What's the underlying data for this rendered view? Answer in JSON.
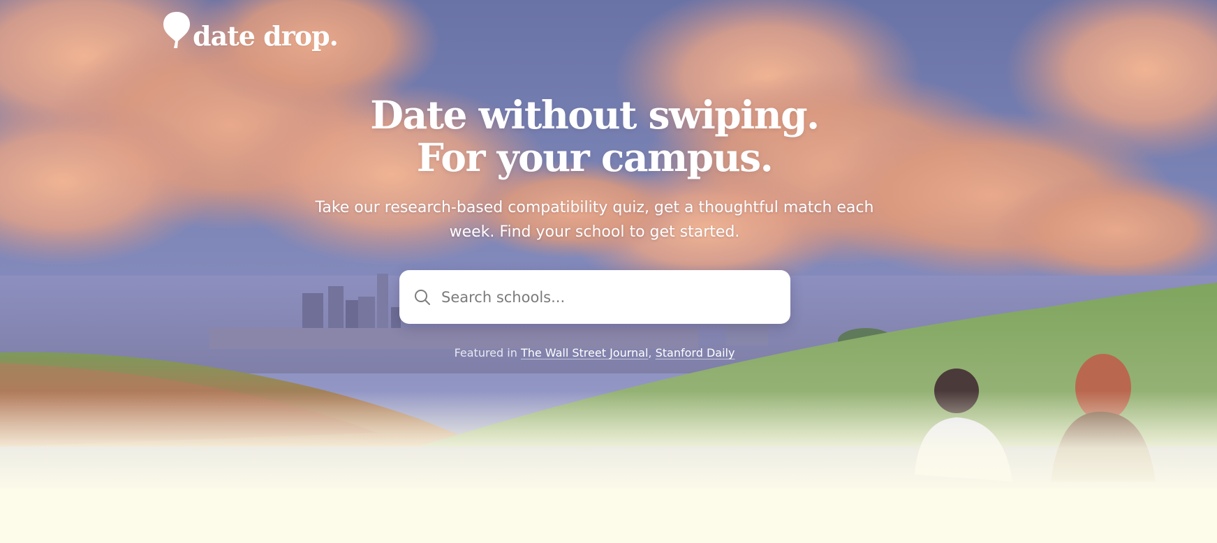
{
  "brand": {
    "name": "date drop.",
    "logo_icon": "balloon-pin-icon"
  },
  "hero": {
    "headline_line1": "Date without swiping.",
    "headline_line2": "For your campus.",
    "subheadline": "Take our research-based compatibility quiz, get a thoughtful match each week. Find your school to get started."
  },
  "search": {
    "placeholder": "Search schools...",
    "value": "",
    "icon": "search-icon"
  },
  "featured": {
    "prefix": "Featured in",
    "outlets": [
      "The Wall Street Journal",
      "Stanford Daily"
    ],
    "separator": ","
  },
  "colors": {
    "text_on_hero": "#ffffff",
    "page_background": "#fdfbea",
    "search_background": "#ffffff"
  }
}
